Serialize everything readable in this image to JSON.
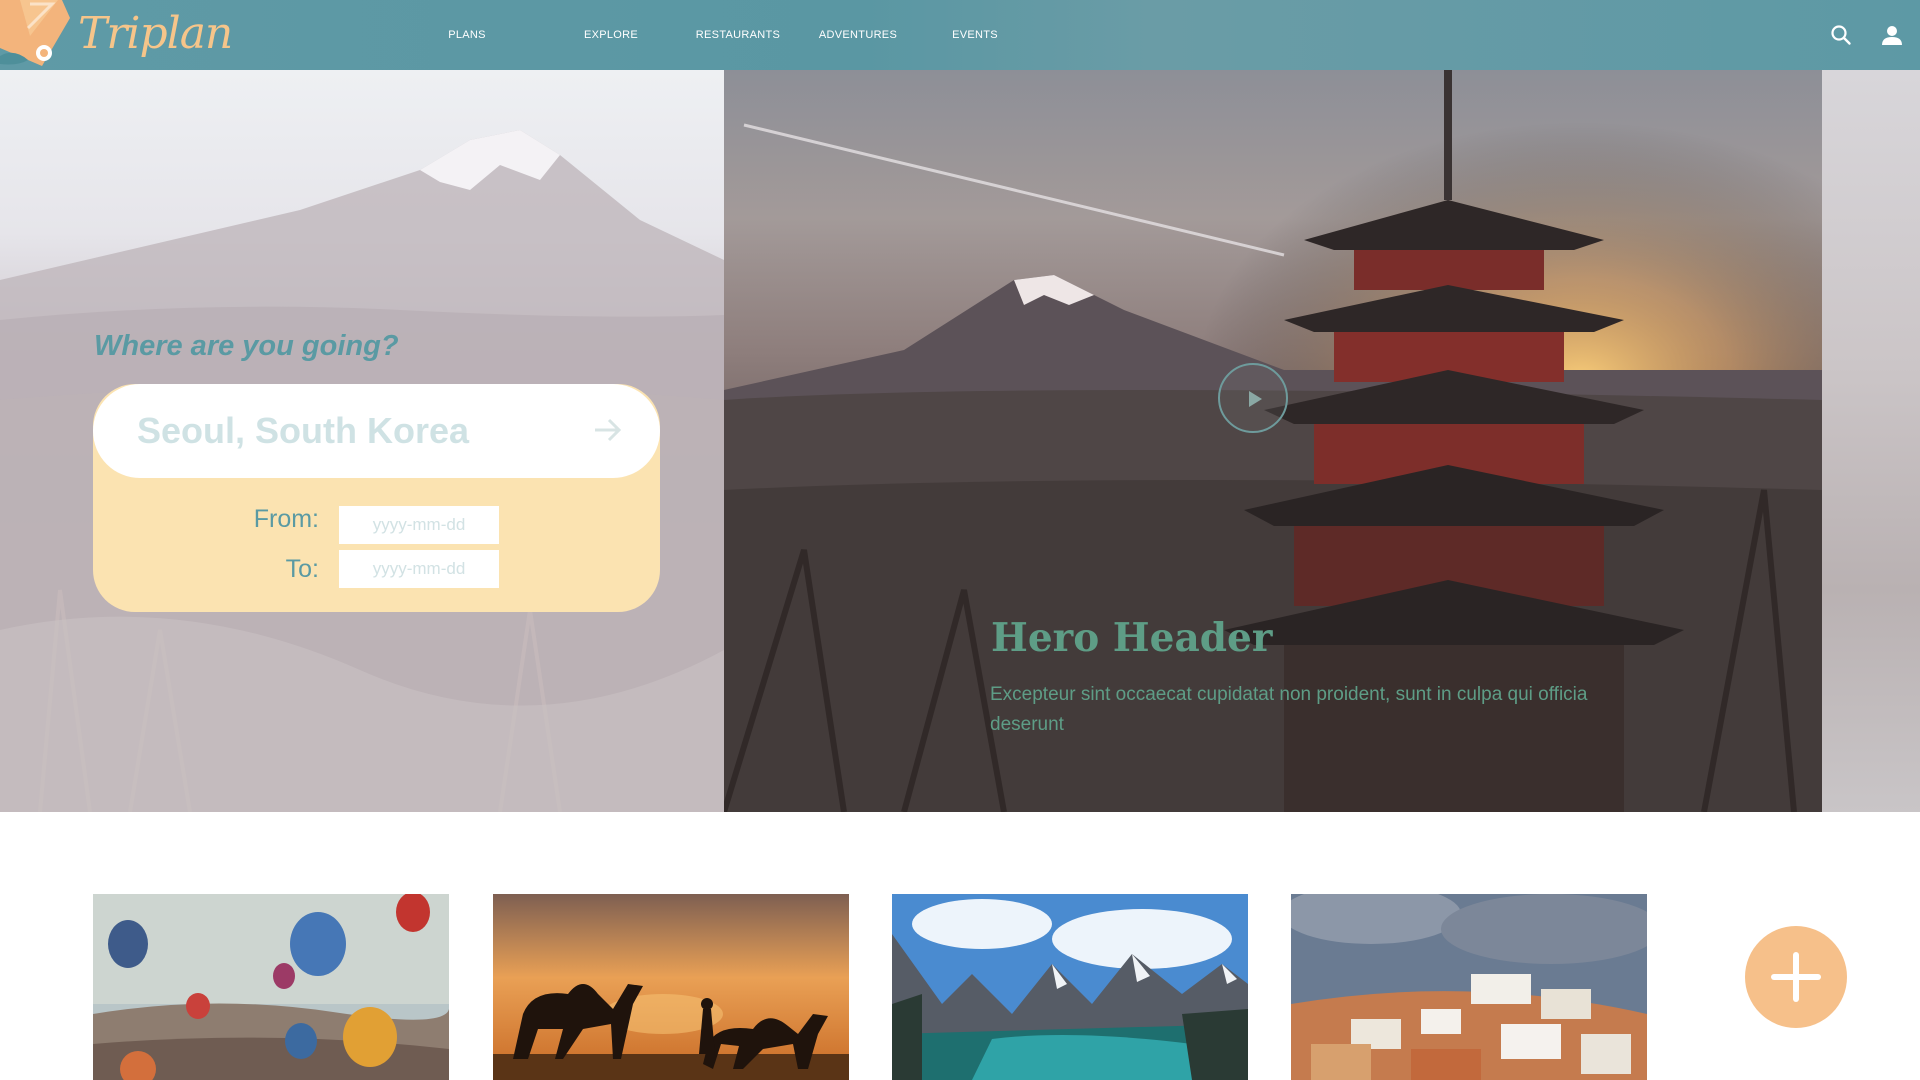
{
  "app": {
    "logo_text": "Triplan"
  },
  "nav": {
    "items": [
      {
        "label": "PLANS"
      },
      {
        "label": "EXPLORE"
      },
      {
        "label": "RESTAURANTS"
      },
      {
        "label": "ADVENTURES"
      },
      {
        "label": "EVENTS"
      }
    ]
  },
  "header_icons": [
    "search-icon",
    "user-icon"
  ],
  "search": {
    "title": "Where are you going?",
    "value": "Seoul, South Korea",
    "submit_icon": "arrow-right-icon",
    "from_label": "From:",
    "to_label": "To:",
    "from_placeholder": "yyyy-mm-dd",
    "to_placeholder": "yyyy-mm-dd"
  },
  "hero": {
    "title": "Hero Header",
    "text": "Excepteur sint occaecat cupidatat non proident, sunt in culpa qui officia deserunt",
    "play_icon": "play-icon"
  },
  "gallery": {
    "cards": [
      {
        "image": "hot-air-balloons"
      },
      {
        "image": "desert-camels-sunset"
      },
      {
        "image": "mountain-lake"
      },
      {
        "image": "coastal-village"
      }
    ],
    "add_icon": "plus-icon"
  },
  "colors": {
    "header_bg": "#5f9aa6",
    "accent_teal": "#5a9aa3",
    "accent_peach": "#f6c08a",
    "search_card_bg": "#fbe3b1",
    "hero_text": "#5e9d86"
  }
}
